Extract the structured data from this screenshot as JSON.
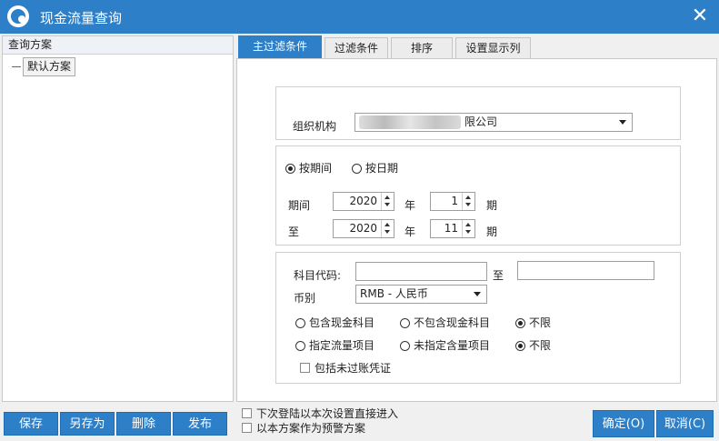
{
  "window": {
    "title": "现金流量查询",
    "close_glyph": "✕"
  },
  "left": {
    "header": "查询方案",
    "tree_item": "默认方案"
  },
  "tabs": [
    {
      "label": "主过滤条件",
      "active": true
    },
    {
      "label": "过滤条件",
      "active": false
    },
    {
      "label": "排序",
      "active": false
    },
    {
      "label": "设置显示列",
      "active": false
    }
  ],
  "org": {
    "label": "组织机构",
    "value_suffix": "限公司"
  },
  "period_mode": {
    "by_period": "按期间",
    "by_date": "按日期",
    "selected": "by_period"
  },
  "period": {
    "from_label": "期间",
    "to_label": "至",
    "year_unit": "年",
    "period_unit": "期",
    "from_year": "2020",
    "from_period": "1",
    "to_year": "2020",
    "to_period": "11"
  },
  "account": {
    "code_label": "科目代码:",
    "to_label": "至",
    "from_value": "",
    "to_value": "",
    "currency_label": "币别",
    "currency_value": "RMB - 人民币"
  },
  "cash_filter": {
    "include_cash": "包含现金科目",
    "exclude_cash": "不包含现金科目",
    "unlimited": "不限",
    "selected": "unlimited"
  },
  "flow_filter": {
    "specified": "指定流量项目",
    "unspecified": "未指定含量项目",
    "unlimited": "不限",
    "selected": "unlimited"
  },
  "include_unposted": "包括未过账凭证",
  "footer": {
    "save": "保存",
    "save_as": "另存为",
    "delete": "删除",
    "publish": "发布",
    "next_login": "下次登陆以本次设置直接进入",
    "as_warning": "以本方案作为预警方案",
    "ok": "确定(O)",
    "cancel": "取消(C)"
  },
  "colors": {
    "accent": "#2d7fc8"
  },
  "icons": [
    "app-logo-icon",
    "close-icon",
    "dropdown-arrow-icon",
    "spin-up-icon",
    "spin-down-icon"
  ]
}
